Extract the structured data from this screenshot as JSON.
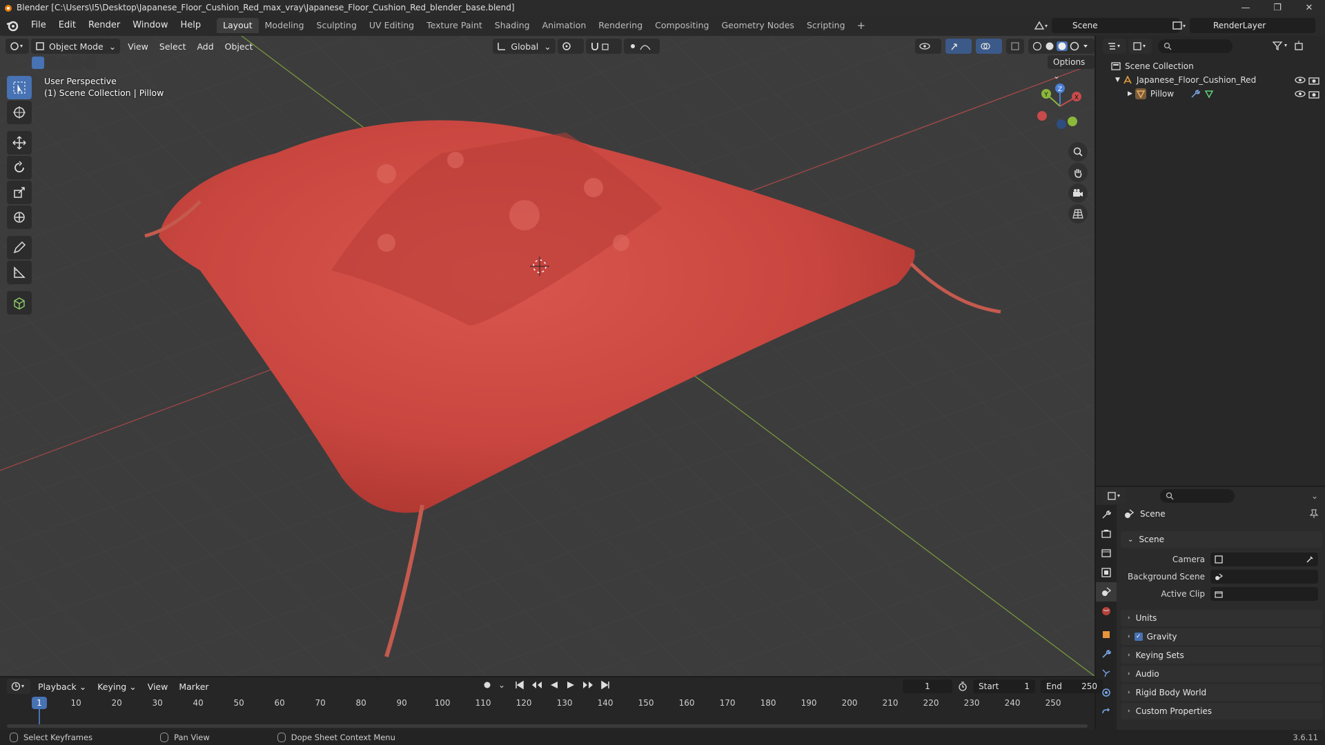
{
  "window": {
    "title": "Blender [C:\\Users\\I5\\Desktop\\Japanese_Floor_Cushion_Red_max_vray\\Japanese_Floor_Cushion_Red_blender_base.blend]",
    "controls": [
      "—",
      "❐",
      "✕"
    ]
  },
  "menubar": {
    "items": [
      "File",
      "Edit",
      "Render",
      "Window",
      "Help"
    ],
    "workspaces": [
      "Layout",
      "Modeling",
      "Sculpting",
      "UV Editing",
      "Texture Paint",
      "Shading",
      "Animation",
      "Rendering",
      "Compositing",
      "Geometry Nodes",
      "Scripting"
    ],
    "active_workspace": "Layout",
    "add_tab": "+",
    "scene": "Scene",
    "view_layer": "RenderLayer"
  },
  "viewport": {
    "mode": "Object Mode",
    "menus": [
      "View",
      "Select",
      "Add",
      "Object"
    ],
    "transform_orientation": "Global",
    "options_label": "Options",
    "perspective_label": "User Perspective",
    "collection_label": "(1) Scene Collection | Pillow",
    "gizmo_axes": {
      "x": "X",
      "y": "Y",
      "z": "Z"
    }
  },
  "outliner": {
    "root": "Scene Collection",
    "collection": "Japanese_Floor_Cushion_Red",
    "object": "Pillow"
  },
  "properties": {
    "context": "Scene",
    "section": "Scene",
    "fields": [
      {
        "label": "Camera",
        "value": ""
      },
      {
        "label": "Background Scene",
        "value": ""
      },
      {
        "label": "Active Clip",
        "value": ""
      }
    ],
    "panels": [
      "Units",
      "Gravity",
      "Keying Sets",
      "Audio",
      "Rigid Body World",
      "Custom Properties"
    ],
    "gravity_checked": true
  },
  "timeline": {
    "menus": [
      "Playback",
      "Keying",
      "View",
      "Marker"
    ],
    "current_frame": "1",
    "start_label": "Start",
    "start": "1",
    "end_label": "End",
    "end": "250",
    "ruler": [
      "10",
      "20",
      "30",
      "40",
      "50",
      "60",
      "70",
      "80",
      "90",
      "100",
      "110",
      "120",
      "130",
      "140",
      "150",
      "160",
      "170",
      "180",
      "190",
      "200",
      "210",
      "220",
      "230",
      "240",
      "250"
    ],
    "playhead": "1"
  },
  "statusbar": {
    "items": [
      "Select Keyframes",
      "Pan View",
      "Dope Sheet Context Menu"
    ],
    "version": "3.6.11"
  },
  "colors": {
    "accent": "#4772b3",
    "cushion": "#c8463f",
    "x_axis": "#c74b4b",
    "y_axis": "#8bb83a",
    "z_axis": "#4a7fd6"
  }
}
